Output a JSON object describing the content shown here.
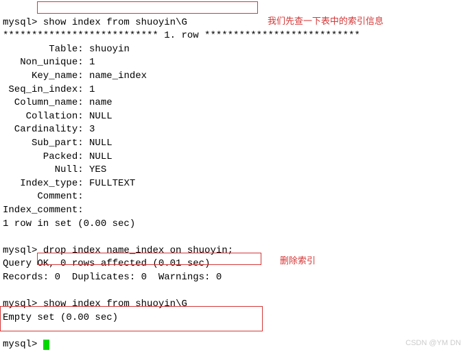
{
  "prompt": "mysql> ",
  "cmd1": "show index from shuoyin\\G",
  "row_header": "*************************** 1. row ***************************",
  "rows": [
    {
      "k": "        Table",
      "v": "shuoyin"
    },
    {
      "k": "   Non_unique",
      "v": "1"
    },
    {
      "k": "     Key_name",
      "v": "name_index"
    },
    {
      "k": " Seq_in_index",
      "v": "1"
    },
    {
      "k": "  Column_name",
      "v": "name"
    },
    {
      "k": "    Collation",
      "v": "NULL"
    },
    {
      "k": "  Cardinality",
      "v": "3"
    },
    {
      "k": "     Sub_part",
      "v": "NULL"
    },
    {
      "k": "       Packed",
      "v": "NULL"
    },
    {
      "k": "         Null",
      "v": "YES"
    },
    {
      "k": "   Index_type",
      "v": "FULLTEXT"
    },
    {
      "k": "      Comment",
      "v": ""
    },
    {
      "k": "Index_comment",
      "v": ""
    }
  ],
  "result1": "1 row in set (0.00 sec)",
  "cmd2": "drop index name_index on shuoyin;",
  "result2a": "Query OK, 0 rows affected (0.01 sec)",
  "result2b": "Records: 0  Duplicates: 0  Warnings: 0",
  "cmd3": "show index from shuoyin\\G",
  "result3": "Empty set (0.00 sec)",
  "note1": "我们先查一下表中的索引信息",
  "note2": "删除索引",
  "watermark": "CSDN @YM  DN"
}
